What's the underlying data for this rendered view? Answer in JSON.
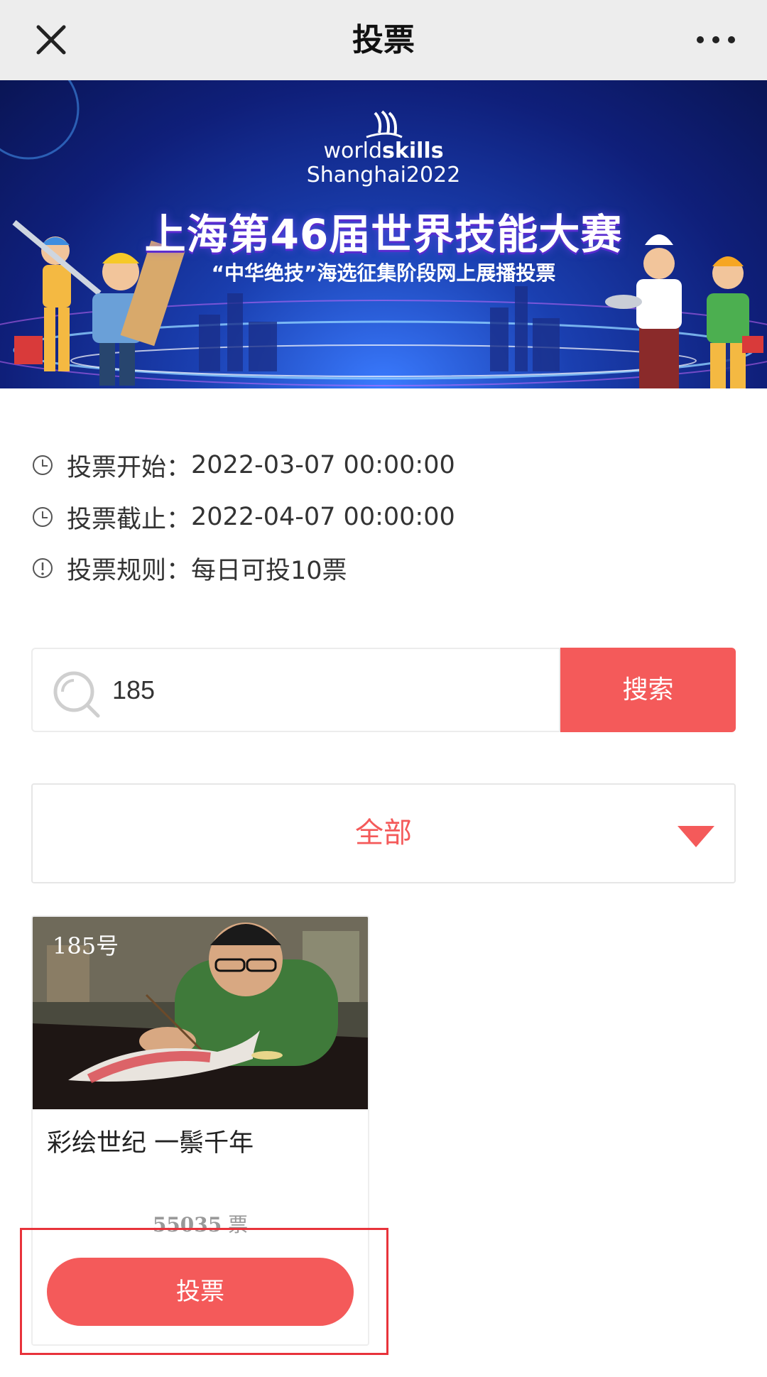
{
  "navbar": {
    "title": "投票",
    "close_icon": "close-icon",
    "more_icon": "more-dots-icon"
  },
  "banner": {
    "logo_word_light": "world",
    "logo_word_bold": "skills",
    "logo_line2": "Shanghai2022",
    "title": "上海第46届世界技能大赛",
    "subtitle": "“中华绝技”海选征集阶段网上展播投票"
  },
  "info": {
    "start": {
      "label": "投票开始：",
      "value": "2022-03-07 00:00:00",
      "icon": "clock-icon"
    },
    "end": {
      "label": "投票截止：",
      "value": "2022-04-07 00:00:00",
      "icon": "clock-icon"
    },
    "rule": {
      "label": "投票规则：",
      "value": "每日可投10票",
      "icon": "info-icon"
    }
  },
  "search": {
    "value": "185",
    "button_label": "搜索"
  },
  "category": {
    "selected": "全部"
  },
  "entry": {
    "number": "185号",
    "title": "彩绘世纪 一鬃千年",
    "votes": "55035",
    "votes_unit": "票",
    "vote_button_label": "投票"
  },
  "colors": {
    "accent": "#f45a5a",
    "navbar_bg": "#ededed",
    "highlight": "#e8333b"
  }
}
